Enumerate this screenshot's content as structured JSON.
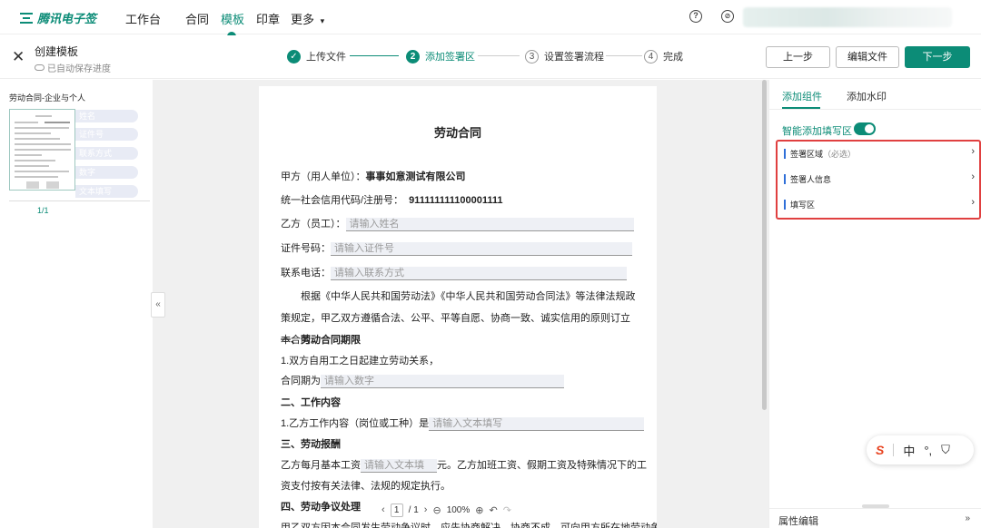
{
  "topnav": {
    "brand": "腾讯电子签",
    "items": [
      {
        "label": "工作台"
      },
      {
        "label": "合同"
      },
      {
        "label": "模板"
      },
      {
        "label": "印章"
      },
      {
        "label": "更多"
      }
    ],
    "more_caret": "▾",
    "help_icon": "?",
    "compass_icon": "⊘"
  },
  "subbar": {
    "title": "创建模板",
    "status": "已自动保存进度",
    "steps": [
      {
        "num": "✓",
        "label": "上传文件"
      },
      {
        "num": "2",
        "label": "添加签署区"
      },
      {
        "num": "3",
        "label": "设置签署流程"
      },
      {
        "num": "4",
        "label": "完成"
      }
    ],
    "buttons": {
      "prev": "上一步",
      "edit": "编辑文件",
      "next": "下一步"
    }
  },
  "left": {
    "doc_name": "劳动合同-企业与个人",
    "thumb_fields": [
      "姓名",
      "证件号",
      "联系方式",
      "数字",
      "文本填写"
    ],
    "page_indicator": "1/1"
  },
  "document": {
    "title": "劳动合同",
    "party_a_label": "甲方（用人单位）：",
    "party_a_value": "事事如意测试有限公司",
    "credit_label": "统一社会信用代码/注册号：",
    "credit_value": "911111111100001111",
    "party_b_label": "乙方（员工）：",
    "party_b_placeholder": "请输入姓名",
    "id_label": "证件号码：",
    "id_placeholder": "请输入证件号",
    "phone_label": "联系电话：",
    "phone_placeholder": "请输入联系方式",
    "intro": "根据《中华人民共和国劳动法》《中华人民共和国劳动合同法》等法律法规政策规定，甲乙双方遵循合法、公平、平等自愿、协商一致、诚实信用的原则订立本合同。",
    "s1_title": "一、劳动合同期限",
    "s1_line1": "1.双方自用工之日起建立劳动关系，",
    "s1_line2_label": "合同期为",
    "s1_line2_placeholder": "请输入数字",
    "s2_title": "二、工作内容",
    "s2_line1_label": "1.乙方工作内容（岗位或工种）是",
    "s2_line1_placeholder": "请输入文本填写",
    "s3_title": "三、劳动报酬",
    "s3_line_prefix": "乙方每月基本工资",
    "s3_line_placeholder": "请输入文本填",
    "s3_line_suffix": "元。乙方加班工资、假期工资及特殊情况下的工",
    "s3_line2": "资支付按有关法律、法规的规定执行。",
    "s4_title": "四、劳动争议处理",
    "s4_line1": "甲乙双方因本合同发生劳动争议时，应先协商解决，协商不成，可向甲方所在地劳动争"
  },
  "pager": {
    "page": "1",
    "total": "/ 1",
    "zoom": "100%"
  },
  "right": {
    "tabs": [
      "添加组件",
      "添加水印"
    ],
    "smart_label": "智能添加填写区",
    "smart_on": true,
    "categories": [
      {
        "label": "签署区域",
        "note": "（必选）"
      },
      {
        "label": "签署人信息",
        "note": ""
      },
      {
        "label": "填写区",
        "note": ""
      }
    ],
    "prop_label": "属性编辑",
    "prop_icon": "»"
  },
  "ime": {
    "logo": "S",
    "lang": "中",
    "punct": "°,",
    "shirt": "⛉"
  },
  "colors": {
    "accent": "#0c8c77",
    "highlight_box": "#e04040",
    "category_bar": "#2f6fd8"
  }
}
